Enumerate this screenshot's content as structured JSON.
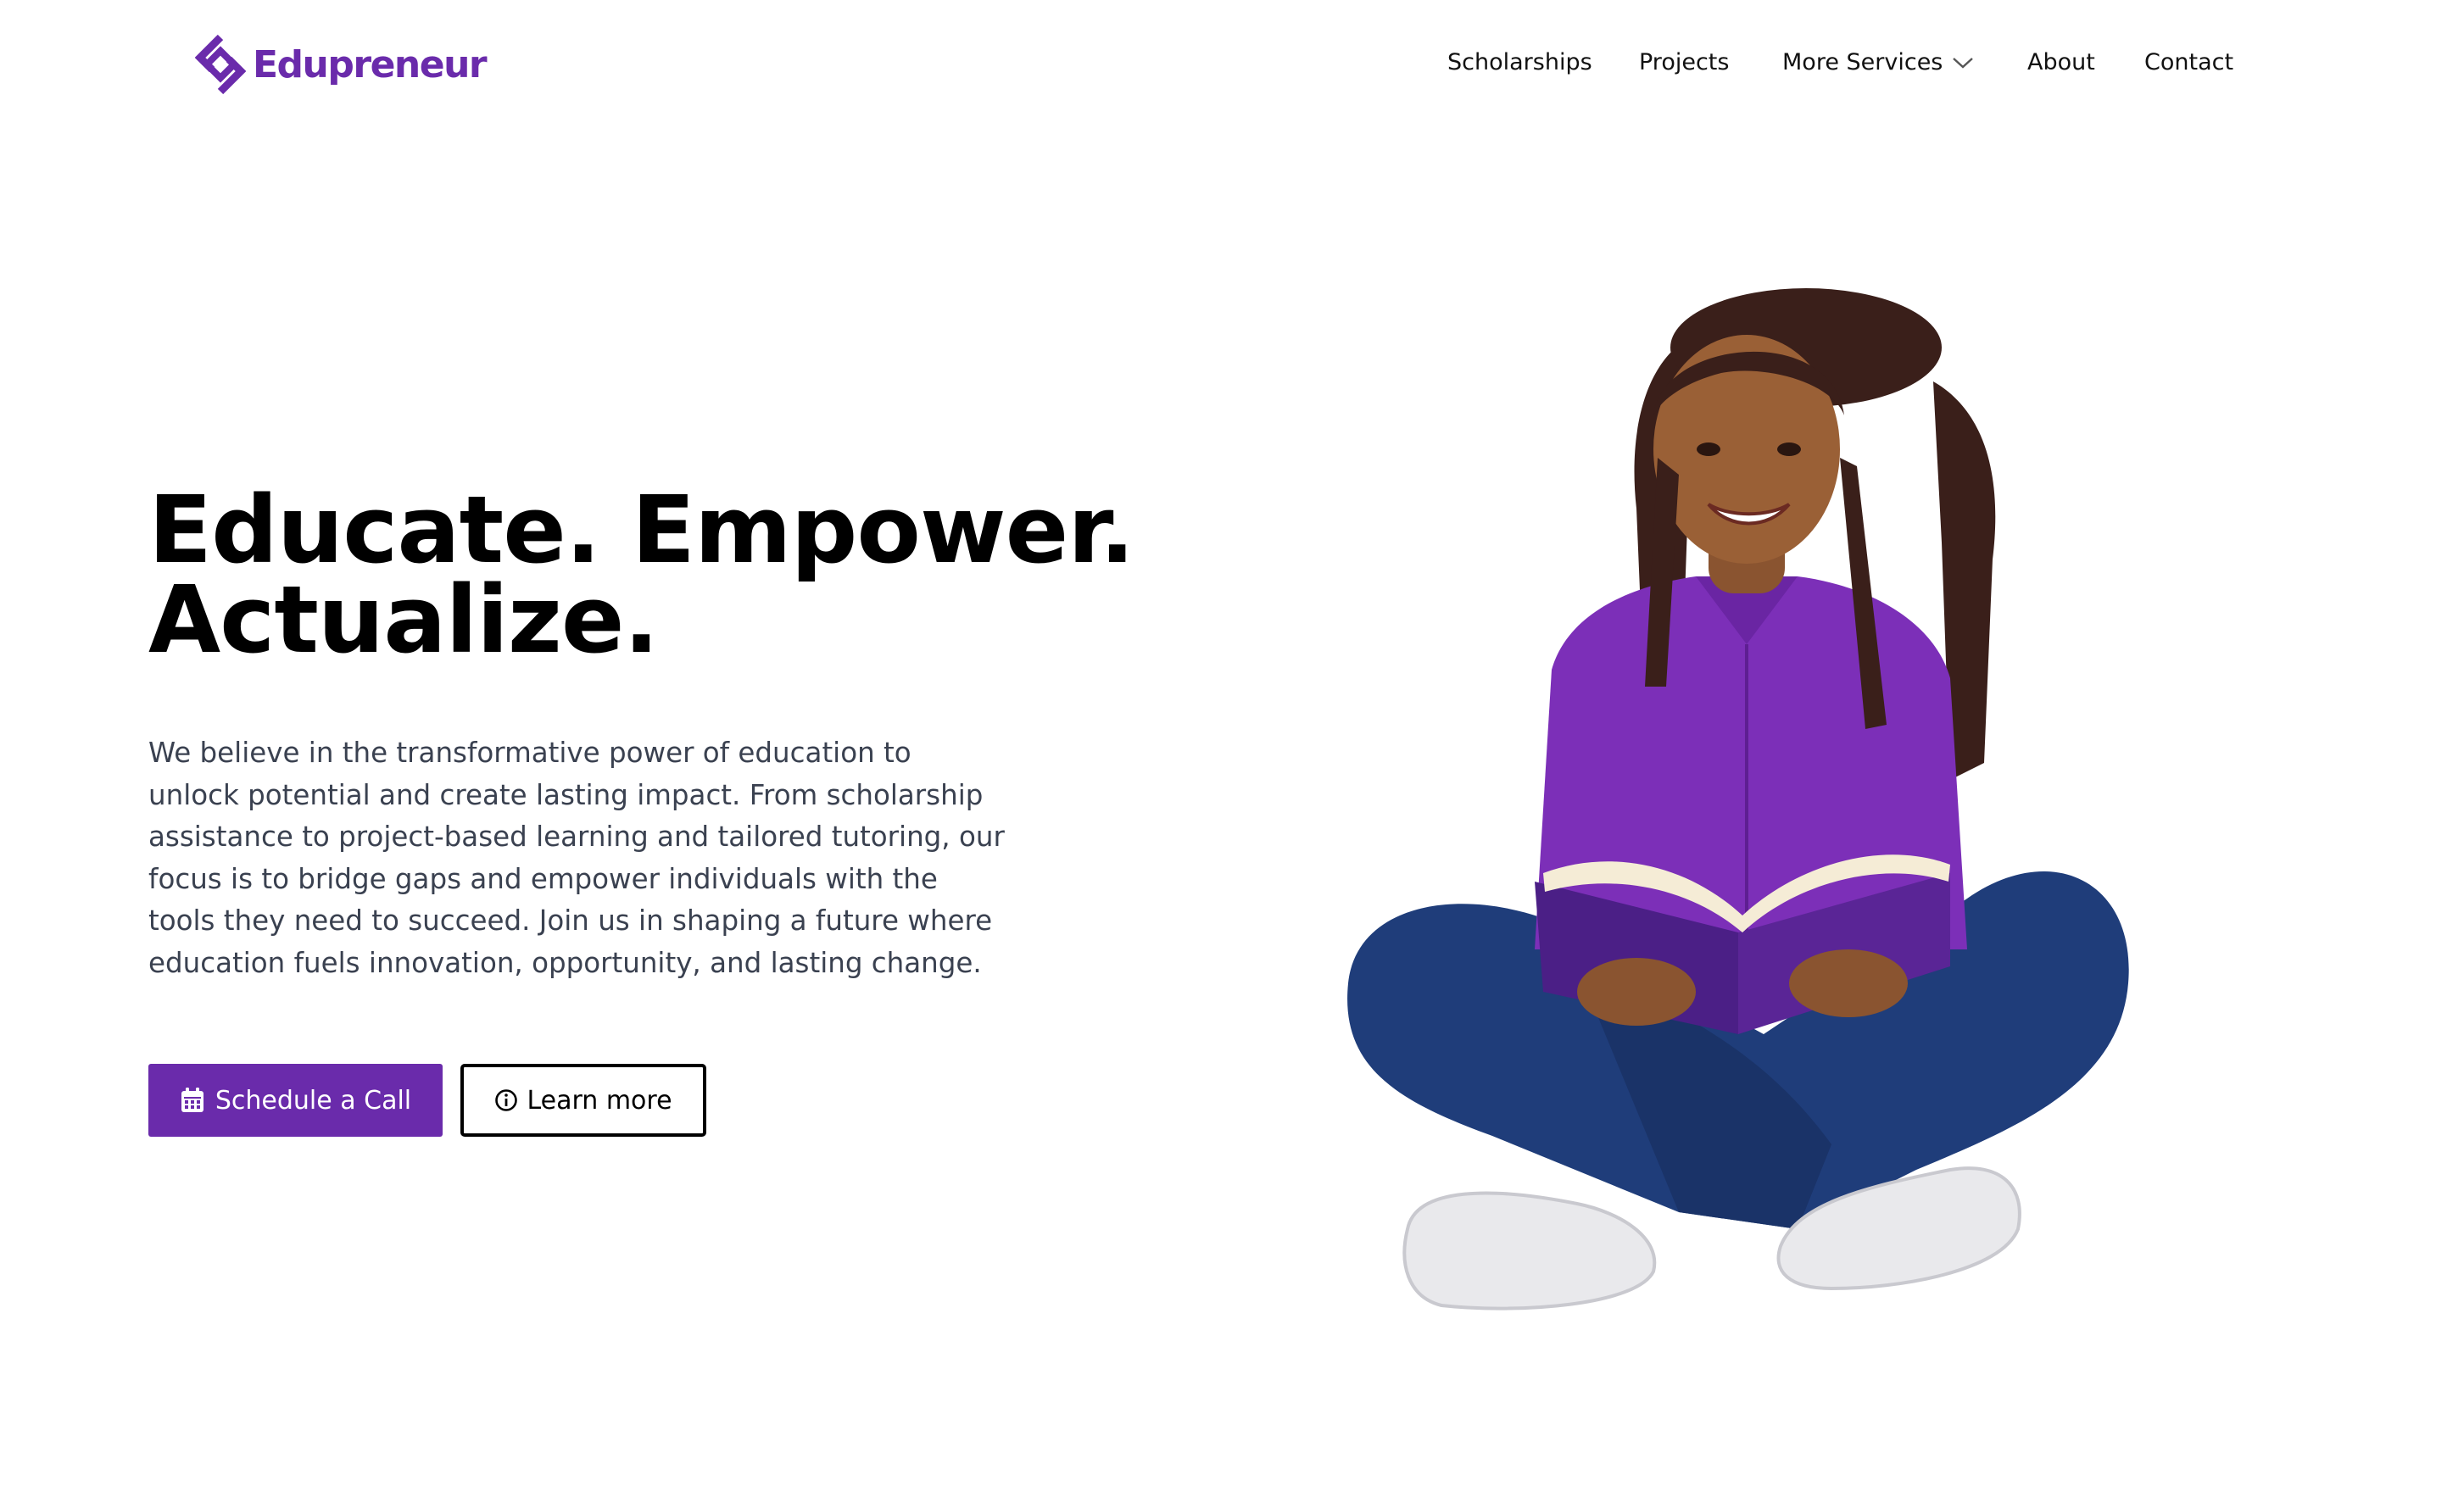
{
  "header": {
    "logo_text": "Edupreneur",
    "nav": {
      "scholarships": "Scholarships",
      "projects": "Projects",
      "more_services": "More Services",
      "about": "About",
      "contact": "Contact"
    }
  },
  "hero": {
    "title_line1": "Educate. Empower.",
    "title_line2": "Actualize.",
    "description": "We believe in the transformative power of education to unlock potential and create lasting impact. From scholarship assistance to project-based learning and tailored tutoring, our focus is to bridge gaps and empower individuals with the tools they need to succeed. Join us in shaping a future where education fuels innovation, opportunity, and lasting change.",
    "primary_button": "Schedule a Call",
    "secondary_button": "Learn more"
  },
  "icons": {
    "logo": "diamond-logo-icon",
    "more_services": "chevron-down-icon",
    "primary_button": "calendar-icon",
    "secondary_button": "info-circle-icon"
  },
  "colors": {
    "brand": "#6a2bab",
    "text_body": "#3a4150",
    "heading": "#000000"
  }
}
